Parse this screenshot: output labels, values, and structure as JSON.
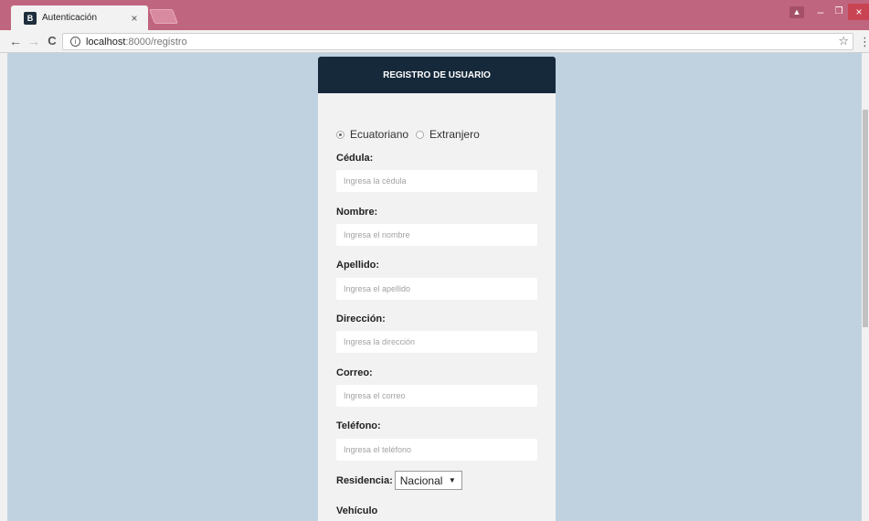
{
  "browser": {
    "tab_title": "Autenticación",
    "tab_favicon": "B",
    "tab_close": "×",
    "url_host": "localhost",
    "url_path": ":8000/registro",
    "win_min": "–",
    "win_max": "❐",
    "win_close": "×"
  },
  "form": {
    "header": "REGISTRO DE USUARIO",
    "nationality": {
      "option1": "Ecuatoriano",
      "option2": "Extranjero"
    },
    "fields": [
      {
        "label": "Cédula:",
        "placeholder": "Ingresa la cédula"
      },
      {
        "label": "Nombre:",
        "placeholder": "Ingresa el nombre"
      },
      {
        "label": "Apellido:",
        "placeholder": "Ingresa el apellido"
      },
      {
        "label": "Dirección:",
        "placeholder": "Ingresa la dirección"
      },
      {
        "label": "Correo:",
        "placeholder": "Ingresa el correo"
      },
      {
        "label": "Teléfono:",
        "placeholder": "Ingresa el teléfono"
      }
    ],
    "residence_label": "Residencia:",
    "residence_value": "Nacional",
    "vehicle_label": "Vehículo"
  }
}
